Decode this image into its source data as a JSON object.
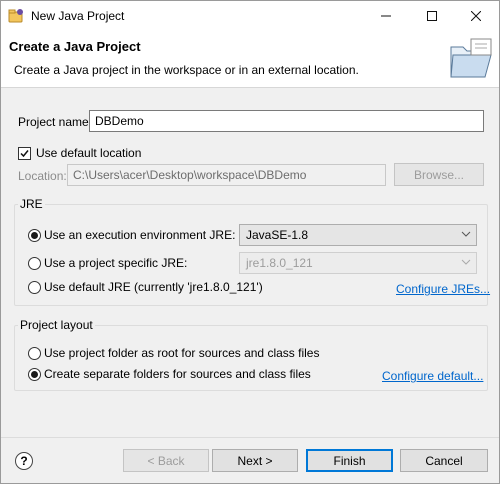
{
  "window": {
    "title": "New Java Project",
    "minimize_icon": "minimize-icon",
    "maximize_icon": "maximize-icon",
    "close_icon": "close-icon"
  },
  "banner": {
    "title": "Create a Java Project",
    "description": "Create a Java project in the workspace or in an external location."
  },
  "project": {
    "name_label": "Project name:",
    "name_value": "DBDemo",
    "use_default_location_label": "Use default location",
    "use_default_location_checked": true,
    "location_label": "Location:",
    "location_value": "C:\\Users\\acer\\Desktop\\workspace\\DBDemo",
    "browse_label": "Browse..."
  },
  "jre": {
    "group_label": "JRE",
    "options": [
      {
        "label": "Use an execution environment JRE:",
        "selected": true
      },
      {
        "label": "Use a project specific JRE:",
        "selected": false
      },
      {
        "label": "Use default JRE (currently 'jre1.8.0_121')",
        "selected": false
      }
    ],
    "exec_env_value": "JavaSE-1.8",
    "project_jre_value": "jre1.8.0_121",
    "configure_link": "Configure JREs..."
  },
  "layout": {
    "group_label": "Project layout",
    "options": [
      {
        "label": "Use project folder as root for sources and class files",
        "selected": false
      },
      {
        "label": "Create separate folders for sources and class files",
        "selected": true
      }
    ],
    "configure_link": "Configure default..."
  },
  "footer": {
    "help_glyph": "?",
    "back_label": "< Back",
    "next_label": "Next >",
    "finish_label": "Finish",
    "cancel_label": "Cancel"
  },
  "colors": {
    "accent": "#0078d7",
    "link": "#0066cc",
    "dialog_bg": "#f0f0f0"
  }
}
